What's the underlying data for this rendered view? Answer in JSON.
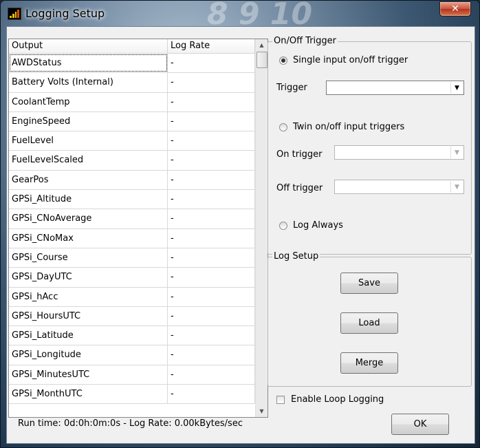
{
  "window": {
    "title": "Logging Setup",
    "title_deco": "8 9 10",
    "close_glyph": "✕"
  },
  "table": {
    "columns": [
      "Output",
      "Log Rate"
    ],
    "rows": [
      [
        "AWDStatus",
        "-"
      ],
      [
        "Battery Volts (Internal)",
        "-"
      ],
      [
        "CoolantTemp",
        "-"
      ],
      [
        "EngineSpeed",
        "-"
      ],
      [
        "FuelLevel",
        "-"
      ],
      [
        "FuelLevelScaled",
        "-"
      ],
      [
        "GearPos",
        "-"
      ],
      [
        "GPSi_Altitude",
        "-"
      ],
      [
        "GPSi_CNoAverage",
        "-"
      ],
      [
        "GPSi_CNoMax",
        "-"
      ],
      [
        "GPSi_Course",
        "-"
      ],
      [
        "GPSi_DayUTC",
        "-"
      ],
      [
        "GPSi_hAcc",
        "-"
      ],
      [
        "GPSi_HoursUTC",
        "-"
      ],
      [
        "GPSi_Latitude",
        "-"
      ],
      [
        "GPSi_Longitude",
        "-"
      ],
      [
        "GPSi_MinutesUTC",
        "-"
      ],
      [
        "GPSi_MonthUTC",
        "-"
      ]
    ],
    "selected_index": 0
  },
  "onoff_trigger": {
    "group_label": "On/Off Trigger",
    "single_label": "Single input on/off trigger",
    "single_checked": true,
    "trigger_label": "Trigger",
    "trigger_value": "",
    "twin_label": "Twin on/off input triggers",
    "on_trigger_label": "On trigger",
    "off_trigger_label": "Off trigger",
    "log_always_label": "Log Always"
  },
  "log_setup": {
    "group_label": "Log Setup",
    "save_label": "Save",
    "load_label": "Load",
    "merge_label": "Merge"
  },
  "enable_loop_logging": {
    "label": "Enable Loop Logging",
    "checked": false
  },
  "status": {
    "text": "Run time: 0d:0h:0m:0s  -  Log Rate: 0.00kBytes/sec"
  },
  "ok_label": "OK",
  "icons": {
    "combo_arrow": "▼",
    "scroll_up": "▲",
    "scroll_down": "▼"
  }
}
